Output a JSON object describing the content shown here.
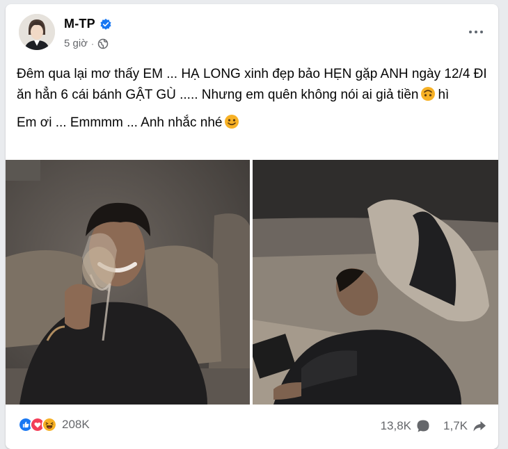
{
  "post": {
    "author": "M-TP",
    "timestamp": "5 giờ",
    "separator": "·",
    "privacy_icon": "globe-icon",
    "verified_icon": "verified-badge-icon",
    "more_icon": "more-options-icon",
    "text_line1_part1": "Đêm qua lại mơ thấy EM ... HẠ LONG xinh đẹp bảo HẸN gặp ANH ngày 12/4 ĐI ăn hẳn 6 cái bánh GẬT GÙ ..... Nhưng em quên không nói ai giả tiền",
    "text_line1_part2": "hì",
    "text_line2": "Em ơi ... Emmmm ... Anh nhắc nhé"
  },
  "reactions": {
    "icons": [
      "like-icon",
      "love-icon",
      "haha-icon"
    ],
    "count": "208K"
  },
  "stats": {
    "comments": "13,8K",
    "shares": "1,7K",
    "comment_icon": "comment-icon",
    "share_icon": "share-icon"
  },
  "colors": {
    "accent": "#1877f2",
    "love": "#f33e58",
    "haha": "#f7b125",
    "muted": "#65676b"
  }
}
